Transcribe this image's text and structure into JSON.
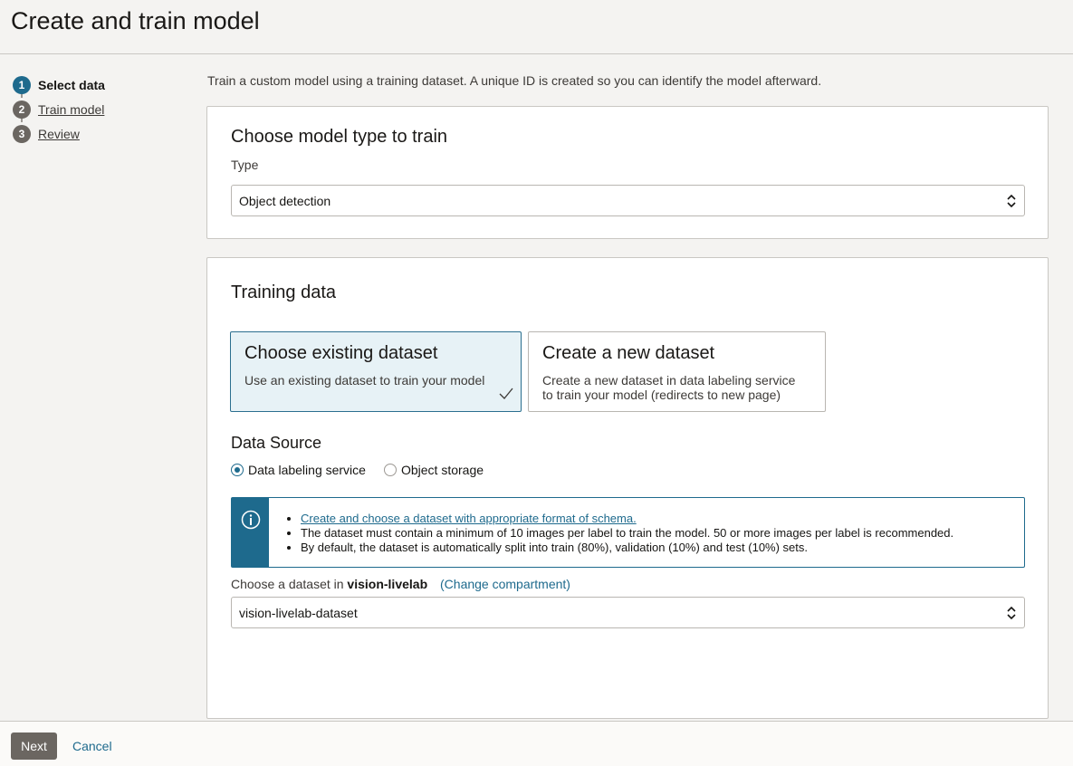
{
  "header": {
    "title": "Create and train model"
  },
  "steps": [
    {
      "num": "1",
      "label": "Select data"
    },
    {
      "num": "2",
      "label": "Train model"
    },
    {
      "num": "3",
      "label": "Review"
    }
  ],
  "intro": "Train a custom model using a training dataset. A unique ID is created so you can identify the model afterward.",
  "model_type": {
    "title": "Choose model type to train",
    "type_label": "Type",
    "type_value": "Object detection"
  },
  "training": {
    "title": "Training data",
    "tiles": [
      {
        "title": "Choose existing dataset",
        "desc": "Use an existing dataset to train your model"
      },
      {
        "title": "Create a new dataset",
        "desc": "Create a new dataset in data labeling service to train your model (redirects to new page)"
      }
    ],
    "data_source_title": "Data Source",
    "radios": [
      {
        "label": "Data labeling service"
      },
      {
        "label": "Object storage"
      }
    ],
    "info": {
      "link": "Create and choose a dataset with appropriate format of schema.",
      "line2": "The dataset must contain a minimum of 10 images per label to train the model. 50 or more images per label is recommended.",
      "line3": "By default, the dataset is automatically split into train (80%), validation (10%) and test (10%) sets."
    },
    "choose_label": "Choose a dataset in",
    "compartment": "vision-livelab",
    "change_compartment": "(Change compartment)",
    "dataset_value": "vision-livelab-dataset"
  },
  "footer": {
    "next": "Next",
    "cancel": "Cancel"
  },
  "colors": {
    "accent": "#1e6a8d",
    "button": "#6b6661"
  }
}
